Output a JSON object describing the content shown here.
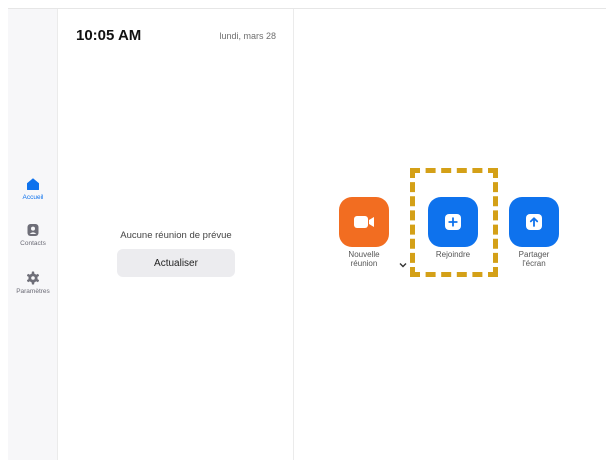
{
  "sidebar": {
    "items": [
      {
        "label": "Accueil",
        "icon": "home-icon",
        "active": true
      },
      {
        "label": "Contacts",
        "icon": "contacts-icon",
        "active": false
      },
      {
        "label": "Paramètres",
        "icon": "gear-icon",
        "active": false
      }
    ]
  },
  "header": {
    "time": "10:05 AM",
    "date": "lundi, mars 28"
  },
  "meetings": {
    "empty_message": "Aucune réunion de prévue",
    "refresh_label": "Actualiser"
  },
  "actions": {
    "new_meeting": {
      "line1": "Nouvelle",
      "line2": "réunion",
      "icon": "video-camera-icon"
    },
    "join": {
      "line1": "Rejoindre",
      "icon": "plus-icon"
    },
    "share": {
      "line1": "Partager",
      "line2": "l'écran",
      "icon": "share-up-arrow-icon"
    }
  },
  "colors": {
    "accent_blue": "#0e72ed",
    "orange": "#f26d21",
    "highlight": "#d4a017"
  }
}
